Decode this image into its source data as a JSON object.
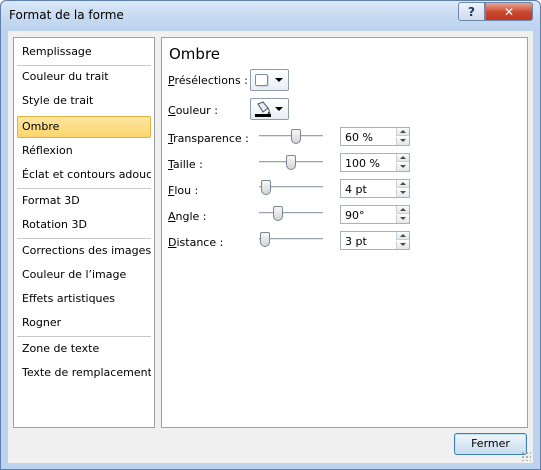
{
  "window": {
    "title": "Format de la forme"
  },
  "titlebar": {
    "help_glyph": "?",
    "close_glyph": "✕"
  },
  "sidebar": {
    "items": [
      {
        "label": "Remplissage",
        "selected": false
      },
      {
        "label": "Couleur du trait",
        "selected": false
      },
      {
        "label": "Style de trait",
        "selected": false
      },
      {
        "label": "Ombre",
        "selected": true
      },
      {
        "label": "Réflexion",
        "selected": false
      },
      {
        "label": "Éclat et contours adoucis",
        "selected": false
      },
      {
        "label": "Format 3D",
        "selected": false
      },
      {
        "label": "Rotation 3D",
        "selected": false
      },
      {
        "label": "Corrections des images",
        "selected": false
      },
      {
        "label": "Couleur de l’image",
        "selected": false
      },
      {
        "label": "Effets artistiques",
        "selected": false
      },
      {
        "label": "Rogner",
        "selected": false
      },
      {
        "label": "Zone de texte",
        "selected": false
      },
      {
        "label": "Texte de remplacement",
        "selected": false
      }
    ]
  },
  "main": {
    "section_title": "Ombre",
    "presets": {
      "label_first": "P",
      "label_rest": "résélections :",
      "icon": "shadow-preset-icon"
    },
    "color": {
      "label_first": "C",
      "label_rest": "ouleur :",
      "icon": "paint-bucket-icon",
      "swatch_color": "#000000"
    },
    "params": [
      {
        "key": "transparency",
        "label_first": "T",
        "label_rest": "ransparence :",
        "value": "60 %",
        "level": 0.6
      },
      {
        "key": "size",
        "label_first": "T",
        "label_rest": "aille :",
        "value": "100 %",
        "level": 0.5
      },
      {
        "key": "blur",
        "label_first": "F",
        "label_rest": "lou :",
        "value": "4 pt",
        "level": 0.04
      },
      {
        "key": "angle",
        "label_first": "A",
        "label_rest": "ngle :",
        "value": "90°",
        "level": 0.25
      },
      {
        "key": "distance",
        "label_first": "D",
        "label_rest": "istance :",
        "value": "3 pt",
        "level": 0.02
      }
    ]
  },
  "footer": {
    "close_label": "Fermer"
  },
  "colors": {
    "selected_bg": "#fbd66e",
    "titlebar": "#c5d9f1",
    "close_red": "#c9462d"
  }
}
